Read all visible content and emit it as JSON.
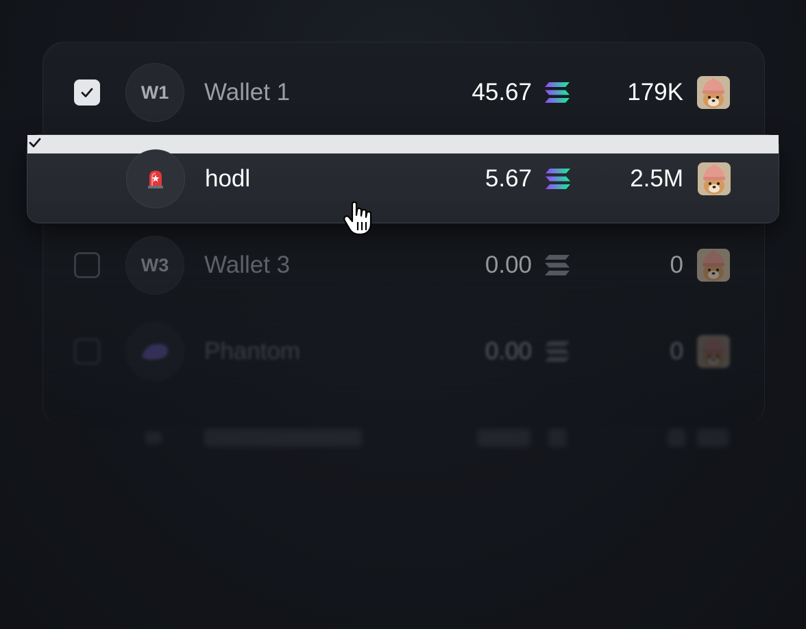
{
  "colors": {
    "background": "#14171d",
    "panel": "#1a1d23",
    "highlight_row": "#2a2e35",
    "checkbox_on": "#e4e6ea",
    "text_primary": "#ffffff",
    "text_secondary": "#9a9da4",
    "sol_gradient": [
      "#9945ff",
      "#14f195"
    ]
  },
  "wallets": [
    {
      "checked": true,
      "avatar_text": "W1",
      "avatar_icon": "",
      "name": "Wallet 1",
      "sol_balance": "45.67",
      "sol_icon": "solana-icon",
      "token_balance": "179K",
      "token_icon": "dog-with-hat-icon"
    },
    {
      "checked": true,
      "avatar_text": "",
      "avatar_icon": "siren-emoji-icon",
      "name": "hodl",
      "sol_balance": "5.67",
      "sol_icon": "solana-icon",
      "token_balance": "2.5M",
      "token_icon": "dog-with-hat-icon",
      "highlighted": true
    },
    {
      "checked": false,
      "avatar_text": "W3",
      "avatar_icon": "",
      "name": "Wallet 3",
      "sol_balance": "0.00",
      "sol_icon": "solana-icon",
      "token_balance": "0",
      "token_icon": "dog-with-hat-icon"
    },
    {
      "checked": false,
      "avatar_text": "",
      "avatar_icon": "phantom-ghost-icon",
      "name": "Phantom",
      "sol_balance": "0.00",
      "sol_icon": "solana-icon",
      "token_balance": "0",
      "token_icon": "dog-with-hat-icon"
    }
  ],
  "cursor": "hand-pointer-cursor"
}
